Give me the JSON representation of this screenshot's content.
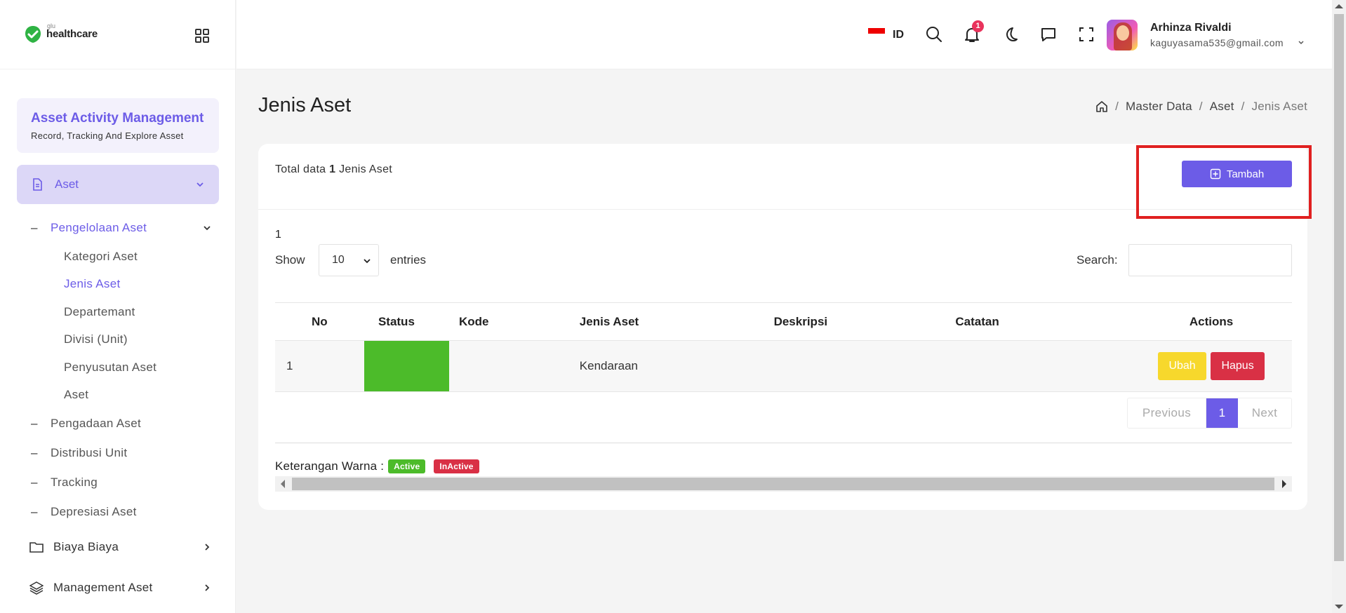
{
  "brand": {
    "small": "glu",
    "name": "healthcare"
  },
  "app": {
    "title": "Asset Activity Management",
    "subtitle": "Record, Tracking And Explore Asset"
  },
  "sidebar": {
    "aset": "Aset",
    "pengelolaan": "Pengelolaan Aset",
    "pengelolaan_items": [
      "Kategori Aset",
      "Jenis Aset",
      "Departemant",
      "Divisi (Unit)",
      "Penyusutan Aset",
      "Aset"
    ],
    "sub_items": [
      "Pengadaan Aset",
      "Distribusi Unit",
      "Tracking",
      "Depresiasi Aset"
    ],
    "biaya": "Biaya Biaya",
    "management": "Management Aset"
  },
  "header": {
    "lang": "ID",
    "notif_count": "1",
    "user_name": "Arhinza Rivaldi",
    "user_email": "kaguyasama535@gmail.com"
  },
  "page": {
    "title": "Jenis Aset"
  },
  "breadcrumb": [
    "Master Data",
    "Aset",
    "Jenis Aset"
  ],
  "card": {
    "total_prefix": "Total data",
    "total_count": "1",
    "total_suffix": "Jenis Aset",
    "add_button": "Tambah",
    "page_indicator": "1",
    "show_label": "Show",
    "page_length": "10",
    "entries_label": "entries",
    "search_label": "Search:"
  },
  "table": {
    "headers": [
      "No",
      "Status",
      "Kode",
      "Jenis Aset",
      "Deskripsi",
      "Catatan",
      "Actions"
    ],
    "rows": [
      {
        "no": "1",
        "status": "active",
        "kode": "",
        "jenis": "Kendaraan",
        "deskripsi": "",
        "catatan": "",
        "edit": "Ubah",
        "delete": "Hapus"
      }
    ]
  },
  "pagination": {
    "prev": "Previous",
    "current": "1",
    "next": "Next"
  },
  "legend": {
    "label": "Keterangan Warna :",
    "active": "Active",
    "inactive": "InActive"
  },
  "colors": {
    "accent": "#6c5ce7",
    "active": "#4cbb2a",
    "danger": "#d93045",
    "warning": "#f7d82c"
  }
}
